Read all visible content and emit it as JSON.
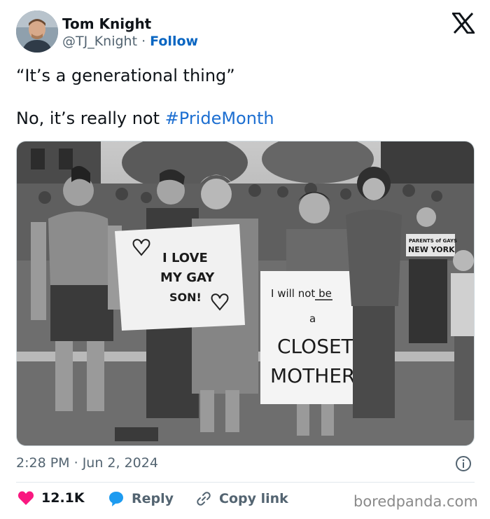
{
  "header": {
    "display_name": "Tom Knight",
    "handle": "@TJ_Knight",
    "separator": " · ",
    "follow_label": "Follow"
  },
  "tweet": {
    "line1": "“It’s a generational thing”",
    "line2_prefix": "No, it’s really not ",
    "hashtag": "#PrideMonth"
  },
  "photo": {
    "sign_love": [
      "I LOVE",
      "MY GAY",
      "SON!"
    ],
    "sign_closet": [
      "I will not be",
      "a",
      "CLOSET",
      "MOTHER"
    ],
    "sign_parents": [
      "PARENTS of GAYS",
      "NEW YORK"
    ]
  },
  "meta": {
    "time": "2:28 PM",
    "separator": " · ",
    "date": "Jun 2, 2024"
  },
  "actions": {
    "likes": "12.1K",
    "reply_label": "Reply",
    "copy_label": "Copy link"
  },
  "watermark": "boredpanda.com",
  "colors": {
    "link_blue": "#0a66c2",
    "hashtag_blue": "#1d6fd1",
    "heart_red": "#f91880",
    "reply_blue": "#1d9bf0",
    "muted": "#536471"
  }
}
